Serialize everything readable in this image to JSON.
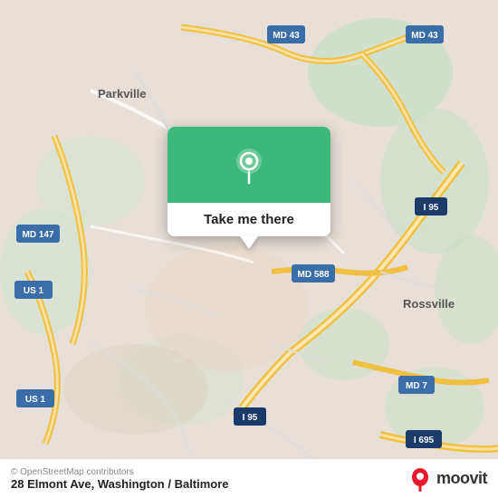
{
  "map": {
    "alt": "Map of Washington / Baltimore area",
    "center_address": "28 Elmont Ave, Washington / Baltimore",
    "osm_credit": "© OpenStreetMap contributors"
  },
  "popup": {
    "label": "Take me there"
  },
  "moovit": {
    "logo_alt": "Moovit",
    "text": "moovit"
  },
  "road_labels": {
    "md43_top": "MD 43",
    "md43_right": "MD 43",
    "md147": "MD 147",
    "i95_center": "I 95",
    "i95_bottom": "I 95",
    "md588": "MD 588",
    "us1_left": "US 1",
    "us1_bottom": "US 1",
    "md7": "MD 7",
    "i695": "I 695",
    "parkville": "Parkville",
    "rossville": "Rossville"
  },
  "colors": {
    "map_bg": "#e8e0d8",
    "road_yellow": "#f5cb5c",
    "road_white": "#ffffff",
    "green_water": "#c8e6c9",
    "popup_green": "#3cb97a",
    "road_label_yellow": "#f5cb5c",
    "road_label_blue": "#4a90d9"
  }
}
